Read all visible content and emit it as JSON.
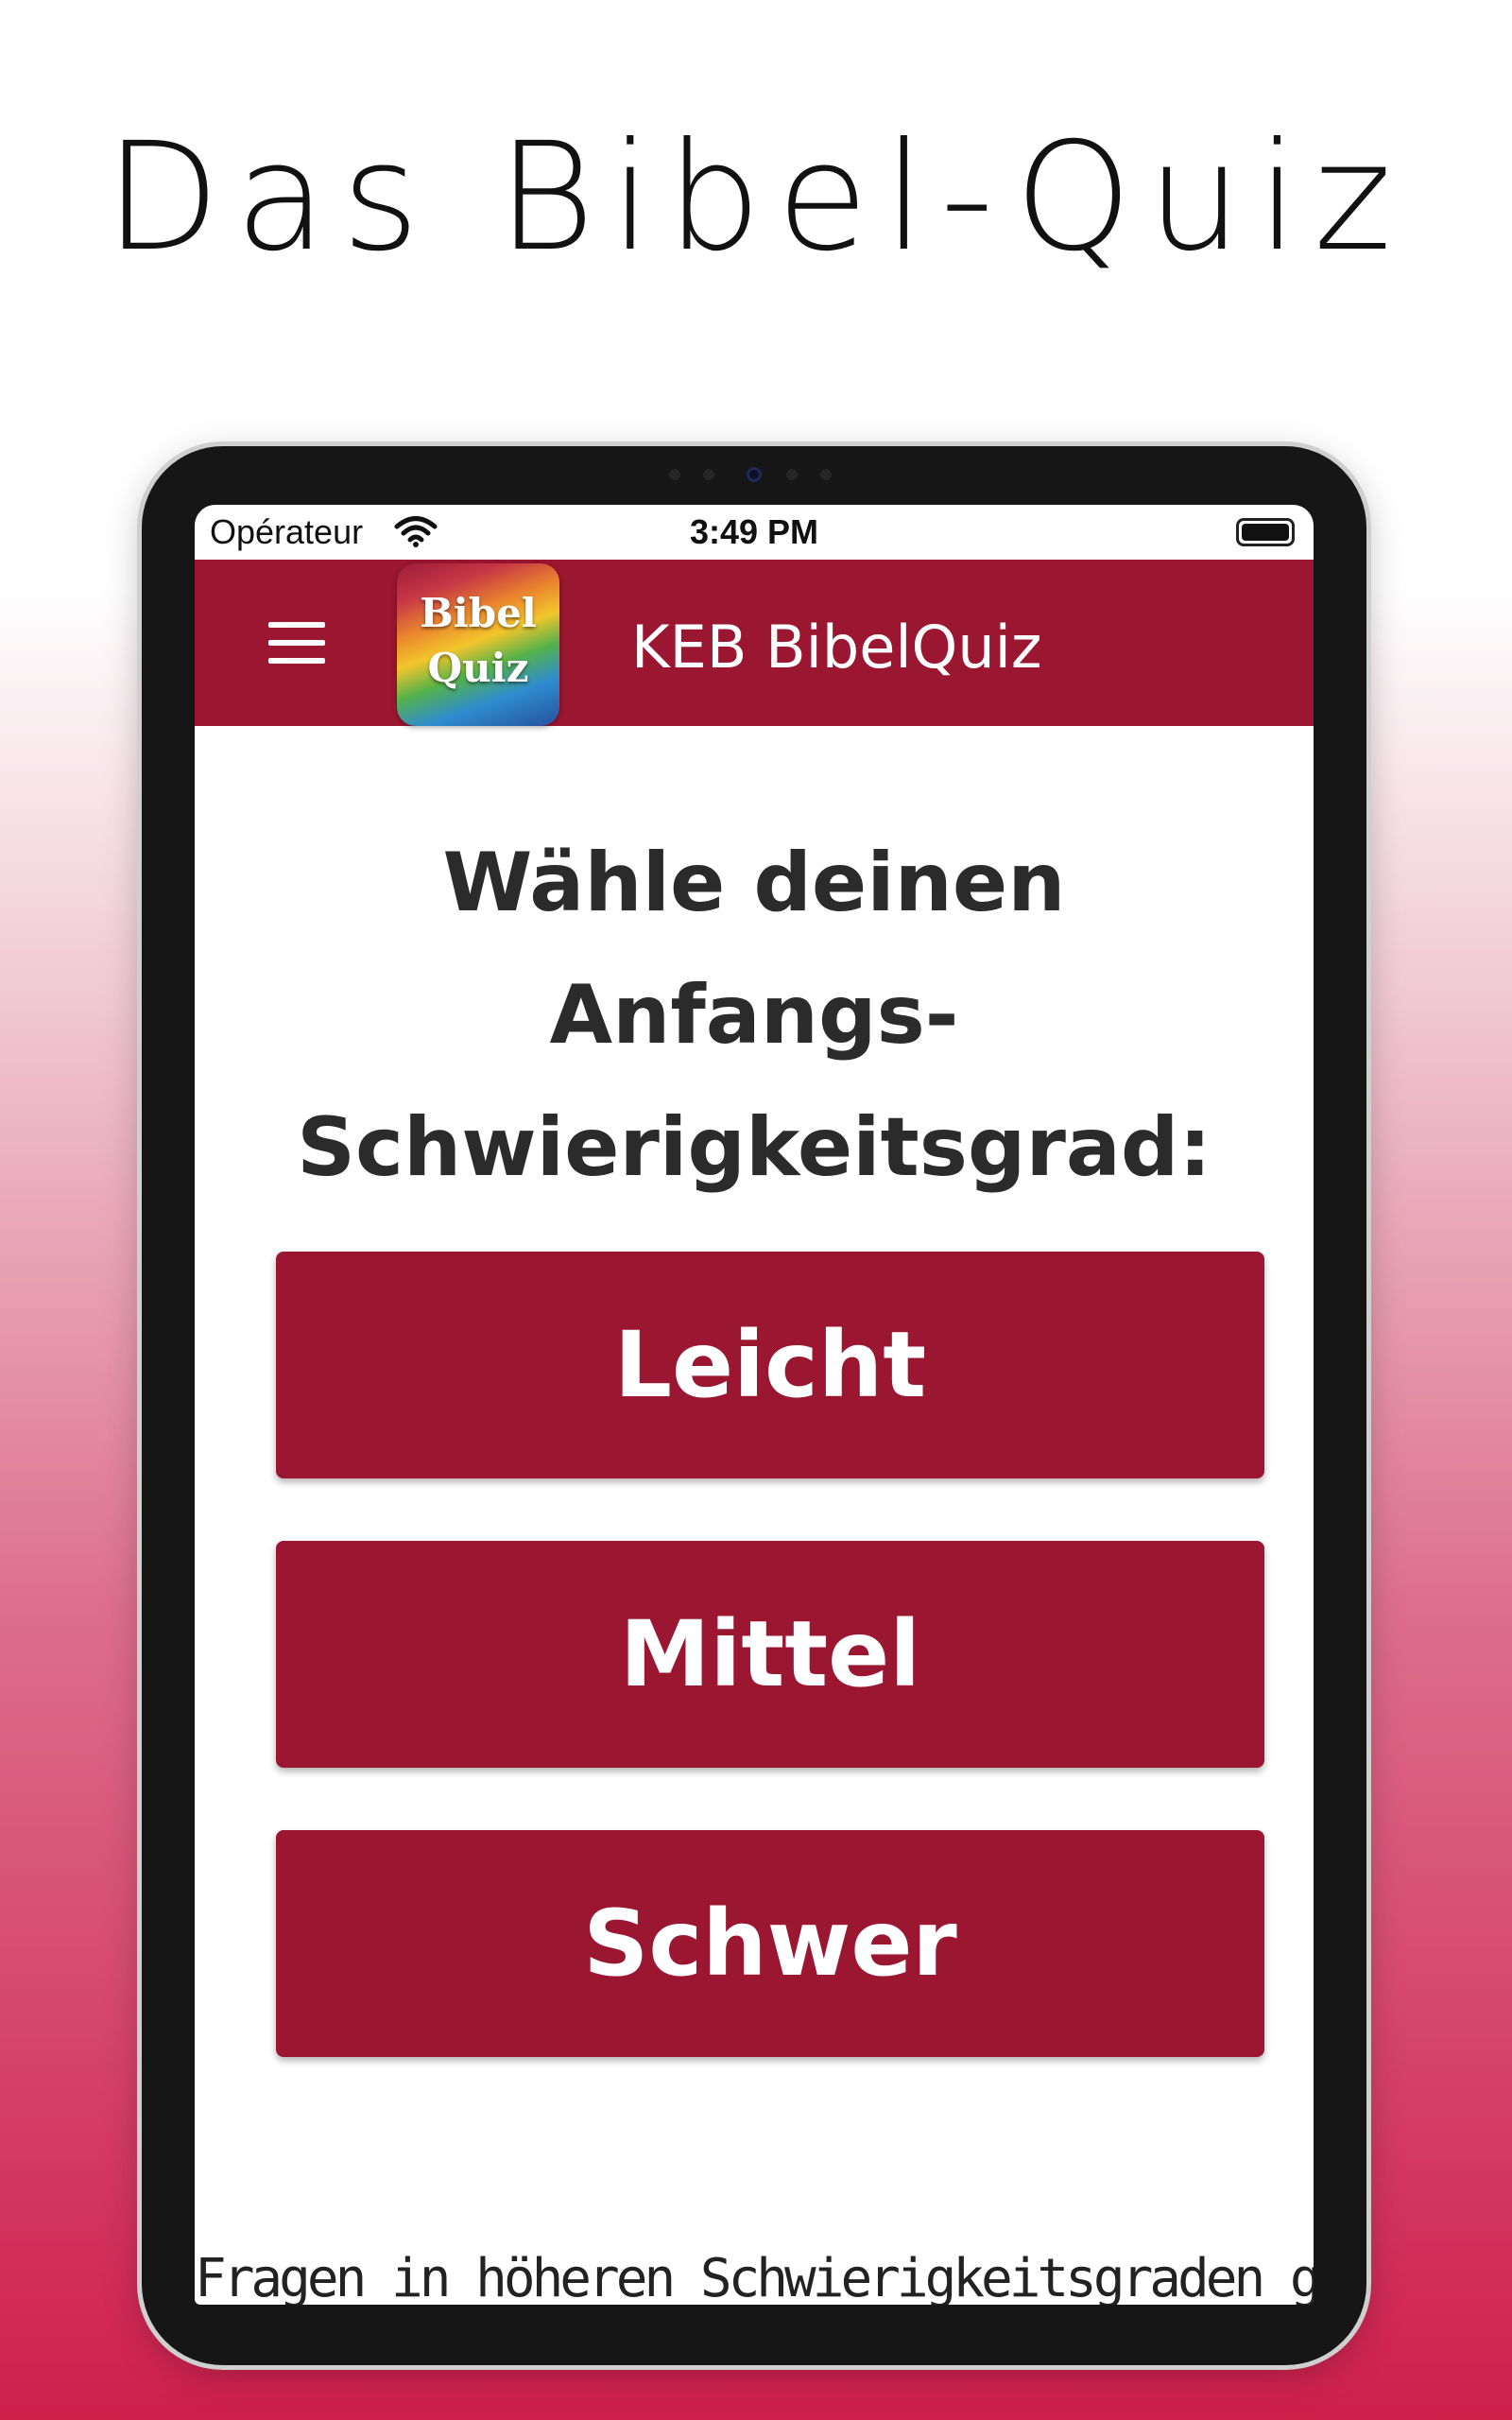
{
  "promo": {
    "title": "Das Bibel-Quiz"
  },
  "status_bar": {
    "carrier": "Opérateur",
    "time": "3:49 PM"
  },
  "app_bar": {
    "title": "KEB BibelQuiz",
    "logo_line1": "Bibel",
    "logo_line2": "Quiz"
  },
  "main": {
    "heading_line1": "Wähle deinen",
    "heading_line2": "Anfangs-",
    "heading_line3": "Schwierigkeitsgrad:",
    "buttons": [
      {
        "label": "Leicht"
      },
      {
        "label": "Mittel"
      },
      {
        "label": "Schwer"
      }
    ],
    "footer_text": "Fragen in höheren Schwierigkeitsgraden geben"
  },
  "icons": {
    "menu": "hamburger-menu-icon",
    "wifi": "wifi-icon",
    "battery": "battery-icon"
  },
  "colors": {
    "brand": "#9b1631",
    "background_gradient_end": "#cf1f4c"
  }
}
